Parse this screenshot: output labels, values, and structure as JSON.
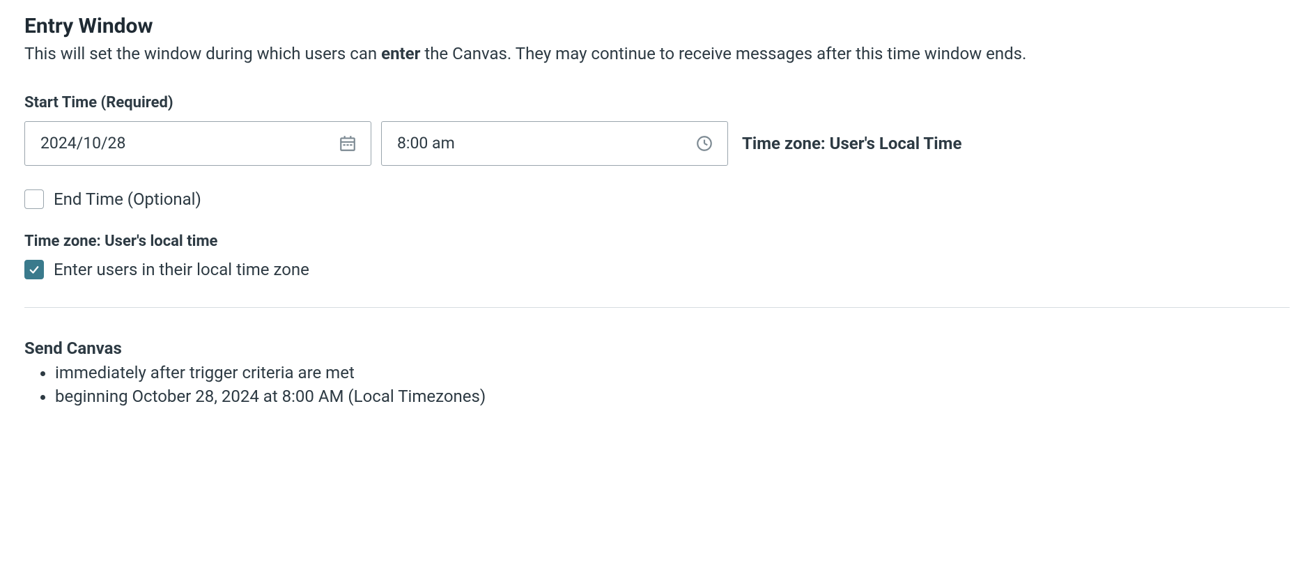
{
  "header": {
    "title": "Entry Window",
    "description_pre": "This will set the window during which users can ",
    "description_bold": "enter",
    "description_post": " the Canvas. They may continue to receive messages after this time window ends."
  },
  "start_time": {
    "label": "Start Time (Required)",
    "date_value": "2024/10/28",
    "time_value": "8:00 am",
    "tz_hint": "Time zone: User's Local Time"
  },
  "end_time": {
    "checked": false,
    "label": "End Time (Optional)"
  },
  "timezone": {
    "heading": "Time zone: User's local time",
    "checkbox_checked": true,
    "checkbox_label": "Enter users in their local time zone"
  },
  "summary": {
    "title": "Send Canvas",
    "items": [
      "immediately after trigger criteria are met",
      "beginning October 28, 2024 at 8:00 AM (Local Timezones)"
    ]
  }
}
